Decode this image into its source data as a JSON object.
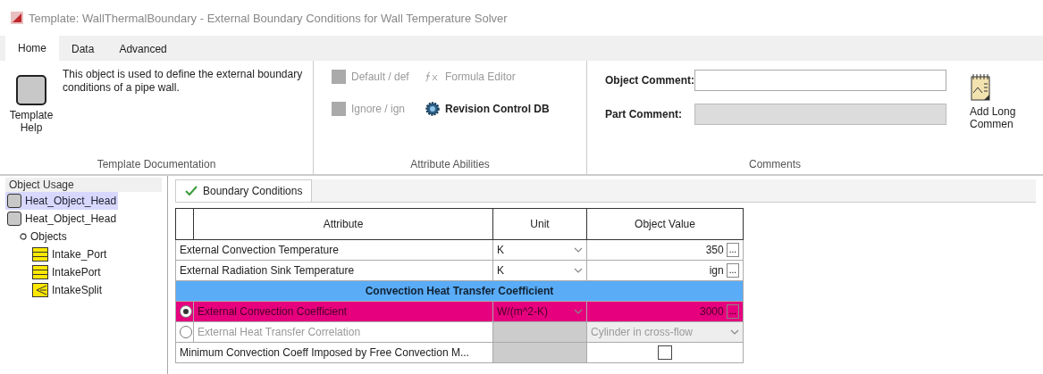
{
  "window": {
    "title": "Template: WallThermalBoundary - External Boundary Conditions for Wall Temperature Solver"
  },
  "ribbon_tabs": [
    {
      "label": "Home",
      "selected": true
    },
    {
      "label": "Data",
      "selected": false
    },
    {
      "label": "Advanced",
      "selected": false
    }
  ],
  "ribbon": {
    "template_help": "Template Help",
    "description": "This object is used to define the external boundary conditions of a pipe wall.",
    "documentation_group": "Template Documentation",
    "attribute_buttons": [
      {
        "kind": "default",
        "label": "Default / def",
        "disabled": true
      },
      {
        "kind": "formula",
        "label": "Formula Editor",
        "disabled": true
      },
      {
        "kind": "ignore",
        "label": "Ignore / ign",
        "disabled": true
      },
      {
        "kind": "revision",
        "label": "Revision Control DB",
        "disabled": false
      }
    ],
    "attribute_group": "Attribute Abilities",
    "comment_fields": [
      {
        "label": "Object Comment:",
        "disabled": false
      },
      {
        "label": "Part Comment:",
        "disabled": true
      }
    ],
    "comments_group": "Comments",
    "long_comment": "Add Long Commen"
  },
  "tree": {
    "title": "Object Usage",
    "items": [
      {
        "kind": "part",
        "label": "Heat_Object_Head",
        "selected": true
      },
      {
        "kind": "part",
        "label": "Heat_Object_Head",
        "selected": false,
        "children": [
          {
            "kind": "folder",
            "label": "Objects",
            "selected": false,
            "children": [
              {
                "kind": "pipe",
                "label": "Intake_Port",
                "selected": false
              },
              {
                "kind": "pipe",
                "label": "IntakePort",
                "selected": false
              },
              {
                "kind": "split",
                "label": "IntakeSplit",
                "selected": false
              }
            ]
          }
        ]
      }
    ]
  },
  "grid_tab": {
    "label": "Boundary Conditions",
    "valid": true
  },
  "table": {
    "columns": [
      "Attribute",
      "Unit",
      "Object Value"
    ],
    "rows": [
      {
        "kind": "value",
        "attribute": "External Convection Temperature",
        "unit": "K",
        "value": "350",
        "button": "..."
      },
      {
        "kind": "value",
        "attribute": "External Radiation Sink Temperature",
        "unit": "K",
        "value": "ign",
        "button": "..."
      },
      {
        "kind": "group",
        "attribute": "Convection Heat Transfer Coefficient"
      },
      {
        "kind": "radio",
        "selected": true,
        "attribute": "External Convection Coefficient",
        "unit": "W/(m^2-K)",
        "value": "3000",
        "button": "..."
      },
      {
        "kind": "radio_choice",
        "selected": false,
        "attribute": "External Heat Transfer Correlation",
        "value": "Cylinder in cross-flow"
      },
      {
        "kind": "checkbox",
        "attribute": "Minimum Convection Coeff Imposed by Free Convection M...",
        "checked": false
      }
    ]
  }
}
